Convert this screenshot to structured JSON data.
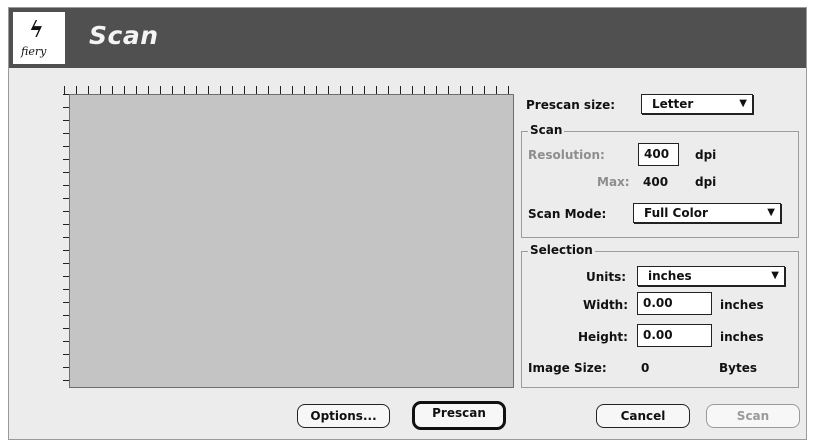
{
  "window": {
    "title": "Scan",
    "logo_text": "fiery",
    "logo_glyph": "ϟ"
  },
  "prescan": {
    "label": "Prescan size:",
    "value": "Letter"
  },
  "scan": {
    "group_title": "Scan",
    "resolution_label": "Resolution:",
    "resolution_value": "400",
    "resolution_unit": "dpi",
    "max_label": "Max:",
    "max_value": "400",
    "max_unit": "dpi",
    "mode_label": "Scan Mode:",
    "mode_value": "Full Color"
  },
  "selection": {
    "group_title": "Selection",
    "units_label": "Units:",
    "units_value": "inches",
    "width_label": "Width:",
    "width_value": "0.00",
    "width_unit": "inches",
    "height_label": "Height:",
    "height_value": "0.00",
    "height_unit": "inches",
    "image_size_label": "Image Size:",
    "image_size_value": "0",
    "image_size_unit": "Bytes"
  },
  "buttons": {
    "options": "Options...",
    "prescan": "Prescan",
    "cancel": "Cancel",
    "scan": "Scan"
  },
  "icons": {
    "dropdown_arrow": "▼"
  },
  "colors": {
    "title_bar": "#505050",
    "preview_area": "#c4c4c4",
    "dialog_bg": "#ececec"
  }
}
